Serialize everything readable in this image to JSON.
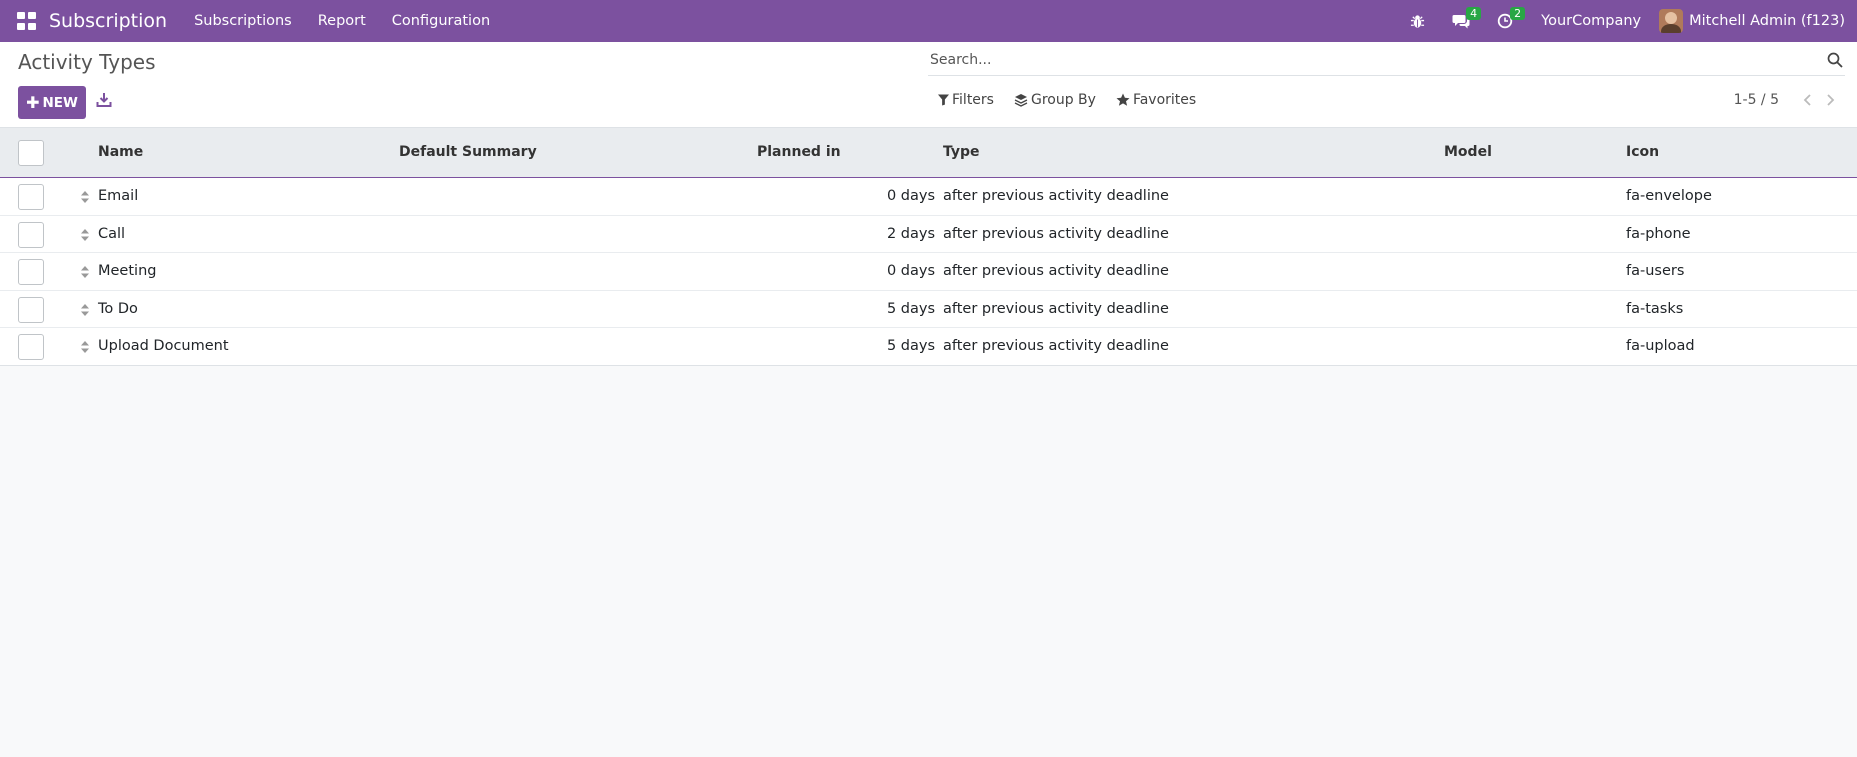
{
  "navbar": {
    "app_name": "Subscription",
    "menu": [
      "Subscriptions",
      "Report",
      "Configuration"
    ],
    "messages_count": "4",
    "activities_count": "2",
    "company": "YourCompany",
    "user": "Mitchell Admin (f123)",
    "accent_color": "#7c519f"
  },
  "control_panel": {
    "title": "Activity Types",
    "new_label": "NEW",
    "search_placeholder": "Search...",
    "filters_label": "Filters",
    "groupby_label": "Group By",
    "favorites_label": "Favorites",
    "pager": "1-5 / 5"
  },
  "table": {
    "headers": {
      "name": "Name",
      "summary": "Default Summary",
      "planned": "Planned in",
      "type": "Type",
      "model": "Model",
      "icon": "Icon"
    },
    "rows": [
      {
        "name": "Email",
        "summary": "",
        "planned": "0 days",
        "type": "after previous activity deadline",
        "model": "",
        "icon": "fa-envelope"
      },
      {
        "name": "Call",
        "summary": "",
        "planned": "2 days",
        "type": "after previous activity deadline",
        "model": "",
        "icon": "fa-phone"
      },
      {
        "name": "Meeting",
        "summary": "",
        "planned": "0 days",
        "type": "after previous activity deadline",
        "model": "",
        "icon": "fa-users"
      },
      {
        "name": "To Do",
        "summary": "",
        "planned": "5 days",
        "type": "after previous activity deadline",
        "model": "",
        "icon": "fa-tasks"
      },
      {
        "name": "Upload Document",
        "summary": "",
        "planned": "5 days",
        "type": "after previous activity deadline",
        "model": "",
        "icon": "fa-upload"
      }
    ]
  }
}
